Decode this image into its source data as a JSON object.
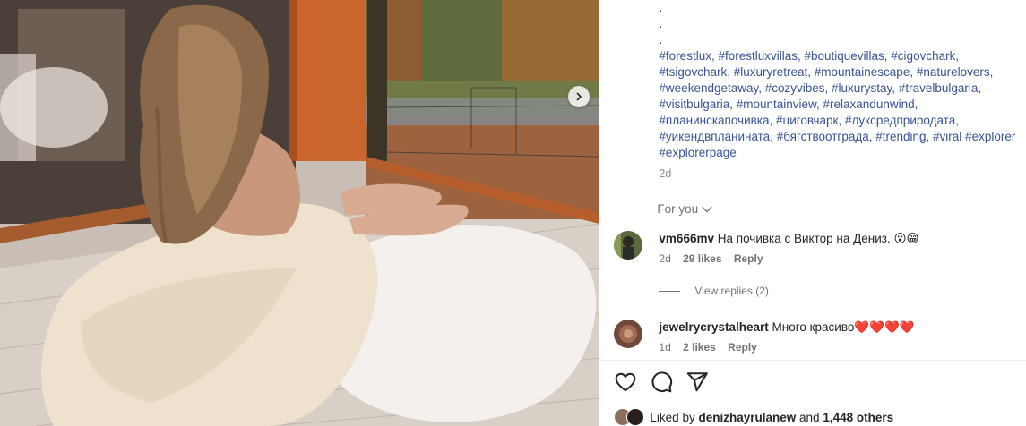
{
  "post": {
    "caption_dots": [
      ".",
      ".",
      "."
    ],
    "hashtag_lines": [
      "#forestlux, #forestluxvillas, #boutiquevillas, #cigovchark,",
      "#tsigovchark, #luxuryretreat, #mountainescape, #naturelovers,",
      "#weekendgetaway, #cozyvibes, #luxurystay, #travelbulgaria,",
      "#visitbulgaria, #mountainview, #relaxandunwind,",
      "#планинскапочивка, #циговчарк, #луксредприродата,",
      "#уикендвпланината, #бягствоотграда, #trending, #viral #explorer",
      "#explorerpage"
    ],
    "time": "2d",
    "for_you_label": "For you"
  },
  "comments": [
    {
      "username": "vm666mv",
      "text": "На почивка с Виктор на Дениз. 😮😁",
      "time": "2d",
      "likes": "29 likes",
      "reply_label": "Reply",
      "view_replies": "View replies (2)"
    },
    {
      "username": "jewelrycrystalheart",
      "text": "Много красиво❤️❤️❤️❤️",
      "time": "1d",
      "likes": "2 likes",
      "reply_label": "Reply"
    }
  ],
  "footer": {
    "liked_prefix": "Liked by",
    "liked_user": "denizhayrulanew",
    "liked_and": "and",
    "liked_others": "1,448 others"
  },
  "icons": {
    "like": "heart-icon",
    "comment": "comment-icon",
    "share": "share-icon",
    "save": "bookmark-icon",
    "next": "chevron-right-icon",
    "for_you_chevron": "chevron-down-icon"
  },
  "colors": {
    "hashtag": "#385398",
    "muted": "#737373",
    "text": "#262626",
    "heart": "#ed1c24"
  }
}
